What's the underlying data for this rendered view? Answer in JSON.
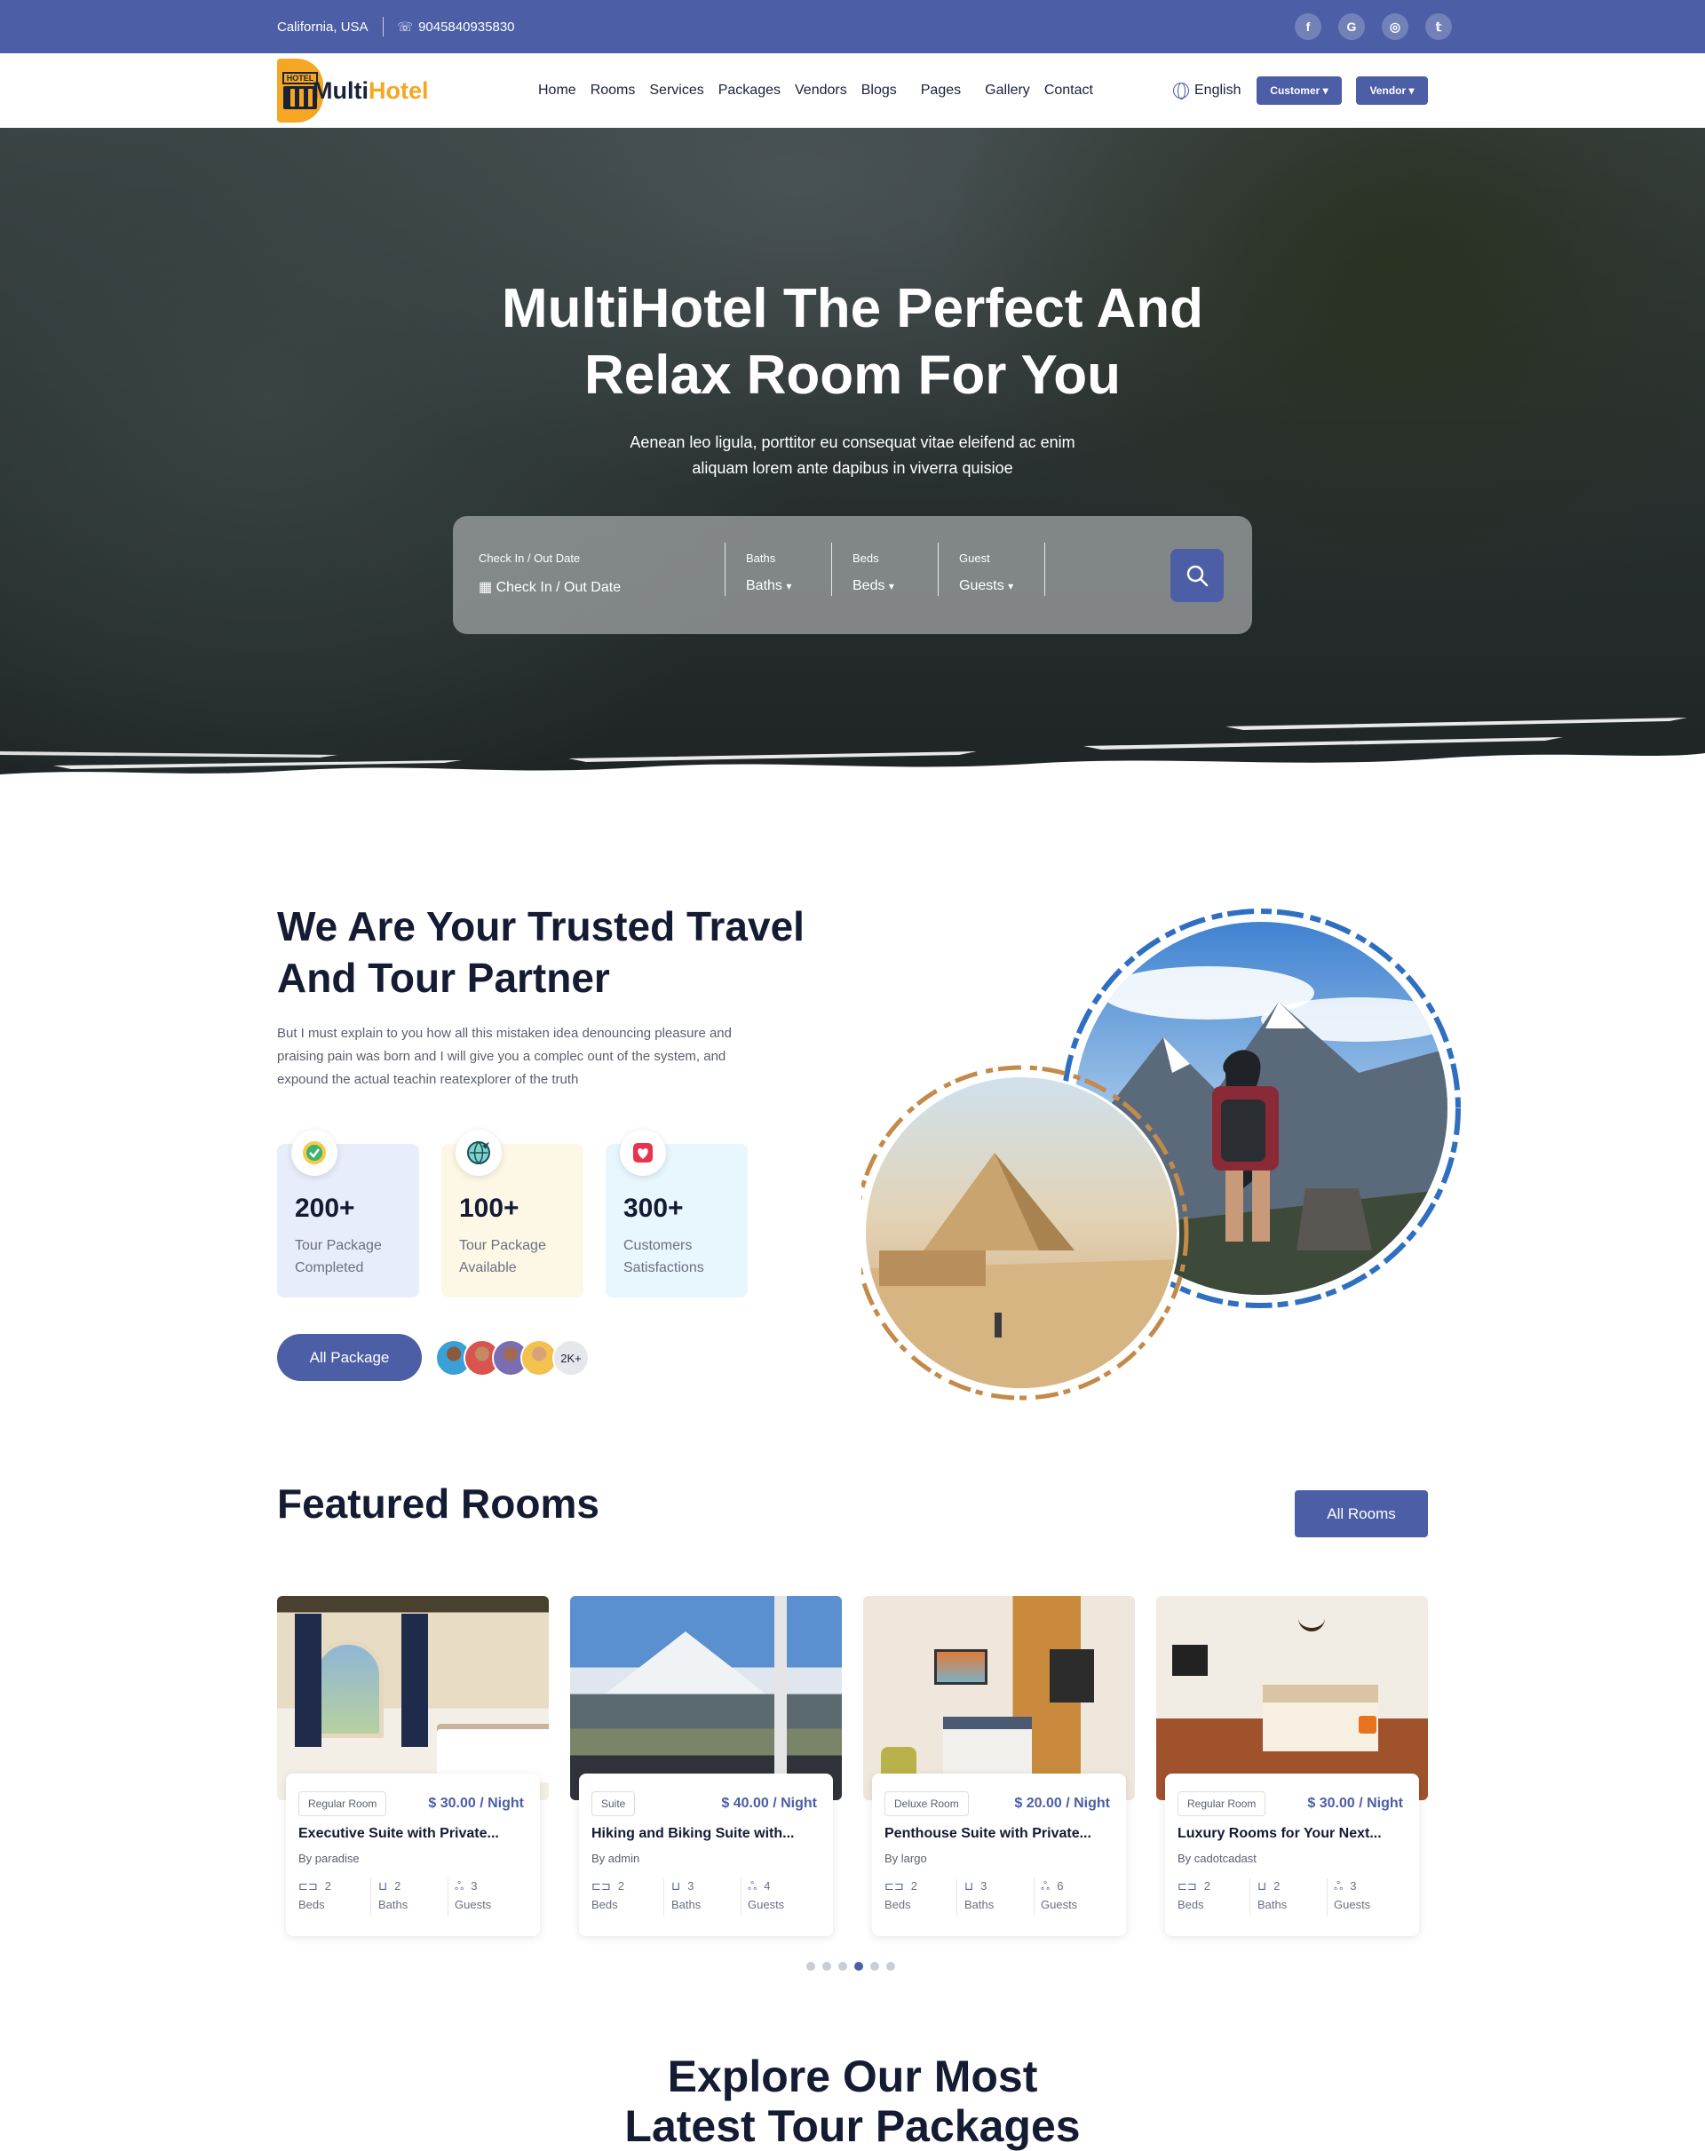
{
  "topbar": {
    "location": "California, USA",
    "phone": "9045840935830",
    "social": [
      "facebook-icon",
      "google-icon",
      "instagram-icon",
      "twitter-icon"
    ]
  },
  "header": {
    "logo_badge": "HOTEL",
    "logo_part1": "Multi",
    "logo_part2": "Hotel",
    "nav": [
      "Home",
      "Rooms",
      "Services",
      "Packages",
      "Vendors",
      "Blogs",
      "Pages",
      "Gallery",
      "Contact"
    ],
    "language": "English",
    "customer_btn": "Customer",
    "vendor_btn": "Vendor"
  },
  "hero": {
    "title_line1": "MultiHotel The Perfect And",
    "title_line2": "Relax Room For You",
    "subtitle_line1": "Aenean leo ligula, porttitor eu consequat vitae eleifend ac enim",
    "subtitle_line2": "aliquam lorem ante dapibus in viverra quisioe",
    "search": {
      "checkin_label": "Check In / Out Date",
      "checkin_value": "Check In / Out Date",
      "baths_label": "Baths",
      "baths_value": "Baths",
      "beds_label": "Beds",
      "beds_value": "Beds",
      "guest_label": "Guest",
      "guest_value": "Guests"
    }
  },
  "about": {
    "title_line1": "We Are Your Trusted Travel",
    "title_line2": "And Tour Partner",
    "text": "But I must explain to you how all this mistaken idea denouncing pleasure and praising pain was born and I will give you a complec ount of the system, and expound the actual teachin reatexplorer of the truth",
    "stats": [
      {
        "number": "200+",
        "label": "Tour Package Completed",
        "color": "#e8edfb",
        "icon": "check-badge-icon"
      },
      {
        "number": "100+",
        "label": "Tour Package Available",
        "color": "#fdf8e6",
        "icon": "globe-plane-icon"
      },
      {
        "number": "300+",
        "label": "Customers Satisfactions",
        "color": "#e8f6fd",
        "icon": "heart-ticket-icon"
      }
    ],
    "button": "All Package",
    "avatars_count": "2K+"
  },
  "featured": {
    "title": "Featured Rooms",
    "button": "All Rooms",
    "rooms": [
      {
        "type": "Regular Room",
        "price": "$ 30.00 / Night",
        "name": "Executive Suite with Private...",
        "by": "By paradise",
        "beds": "2",
        "baths": "2",
        "guests": "3"
      },
      {
        "type": "Suite",
        "price": "$ 40.00 / Night",
        "name": "Hiking and Biking Suite with...",
        "by": "By admin",
        "beds": "2",
        "baths": "3",
        "guests": "4"
      },
      {
        "type": "Deluxe Room",
        "price": "$ 20.00 / Night",
        "name": "Penthouse Suite with Private...",
        "by": "By largo",
        "beds": "2",
        "baths": "3",
        "guests": "6"
      },
      {
        "type": "Regular Room",
        "price": "$ 30.00 / Night",
        "name": "Luxury Rooms for Your Next...",
        "by": "By cadotcadast",
        "beds": "2",
        "baths": "2",
        "guests": "3"
      }
    ],
    "labels": {
      "beds": "Beds",
      "baths": "Baths",
      "guests": "Guests"
    },
    "slider_active": 4,
    "slider_count": 6
  },
  "explore": {
    "title_line1": "Explore Our Most",
    "title_line2": "Latest Tour Packages"
  }
}
